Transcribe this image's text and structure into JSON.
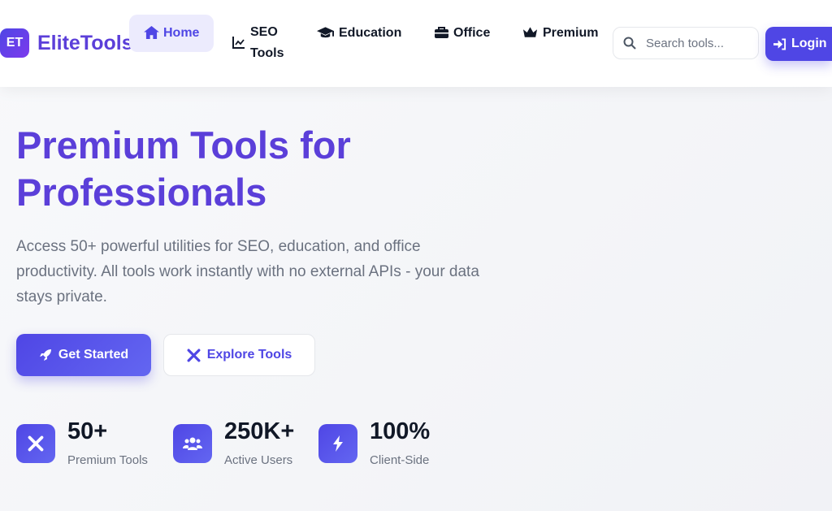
{
  "brand": {
    "badge": "ET",
    "name": "EliteTools"
  },
  "nav": [
    {
      "label": "Home"
    },
    {
      "label": "SEO Tools",
      "line1": "SEO",
      "line2": "Tools"
    },
    {
      "label": "Education"
    },
    {
      "label": "Office"
    },
    {
      "label": "Premium"
    }
  ],
  "search": {
    "placeholder": "Search tools..."
  },
  "login": {
    "label": "Login"
  },
  "hero": {
    "title": "Premium Tools for Professionals",
    "description": "Access 50+ powerful utilities for SEO, education, and office productivity. All tools work instantly with no external APIs - your data stays private.",
    "primary": "Get Started",
    "secondary": "Explore Tools"
  },
  "stats": [
    {
      "value": "50+",
      "label": "Premium Tools"
    },
    {
      "value": "250K+",
      "label": "Active Users"
    },
    {
      "value": "100%",
      "label": "Client-Side"
    }
  ],
  "colors": {
    "accent": "#4f46e5",
    "brand": "#5b3fd9"
  }
}
